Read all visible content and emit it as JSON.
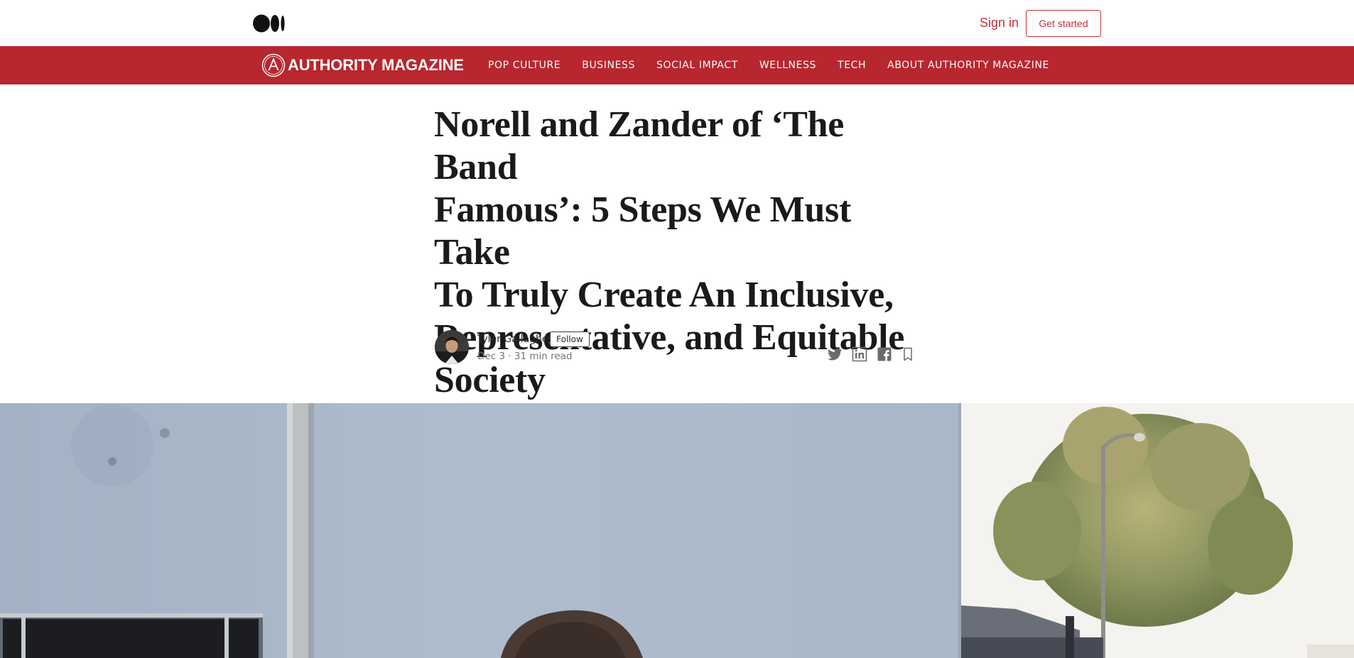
{
  "header": {
    "logo_icon": "medium-logo-icon",
    "sign_in": "Sign in",
    "get_started": "Get started"
  },
  "publication": {
    "name": "AUTHORITY MAGAZINE",
    "emblem_icon": "authority-a-emblem-icon",
    "brand_color": "#b8262e",
    "nav": [
      "POP CULTURE",
      "BUSINESS",
      "SOCIAL IMPACT",
      "WELLNESS",
      "TECH",
      "ABOUT AUTHORITY MAGAZINE"
    ]
  },
  "article": {
    "title_lines": [
      "Norell and Zander of ‘The Band",
      "Famous’: 5 Steps We Must Take",
      "To Truly Create An Inclusive,",
      "Representative, and Equitable",
      "Society"
    ],
    "author": "Tyler Gallagher",
    "follow": "Follow",
    "meta": "Dec 3 · 31 min read",
    "share_icons": [
      "twitter-icon",
      "linkedin-icon",
      "facebook-icon",
      "bookmark-icon"
    ]
  },
  "colors": {
    "accent": "#c4303a",
    "nav_bg": "#b8262e",
    "title_text": "#1a1a1a",
    "meta_text": "#757575"
  }
}
